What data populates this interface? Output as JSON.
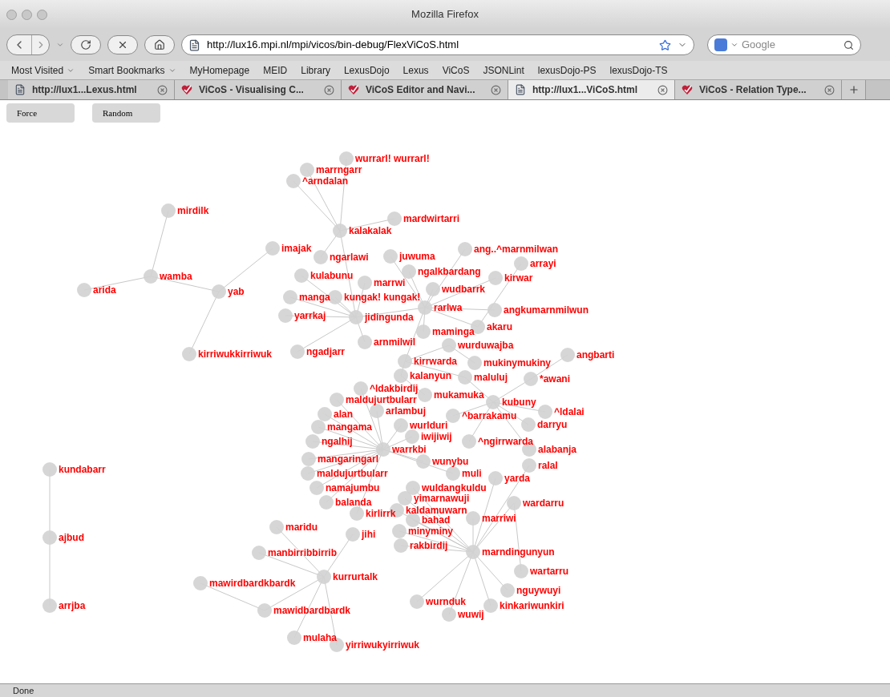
{
  "window": {
    "title": "Mozilla Firefox"
  },
  "toolbar": {
    "url": "http://lux16.mpi.nl/mpi/vicos/bin-debug/FlexViCoS.html",
    "search_placeholder": "Google"
  },
  "bookmarks": [
    {
      "label": "Most Visited",
      "kind": "menu"
    },
    {
      "label": "Smart Bookmarks",
      "kind": "menu"
    },
    {
      "label": "MyHomepage",
      "kind": "link"
    },
    {
      "label": "MEID",
      "kind": "link"
    },
    {
      "label": "Library",
      "kind": "link"
    },
    {
      "label": "LexusDojo",
      "kind": "link"
    },
    {
      "label": "Lexus",
      "kind": "link"
    },
    {
      "label": "ViCoS",
      "kind": "link"
    },
    {
      "label": "JSONLint",
      "kind": "link"
    },
    {
      "label": "lexusDojo-PS",
      "kind": "link"
    },
    {
      "label": "lexusDojo-TS",
      "kind": "link"
    }
  ],
  "tabs": [
    {
      "label": "http://lux1...Lexus.html",
      "kind": "page",
      "selected": false
    },
    {
      "label": "ViCoS - Visualising C...",
      "kind": "vicos",
      "selected": false
    },
    {
      "label": "ViCoS Editor and Navi...",
      "kind": "vicos",
      "selected": false
    },
    {
      "label": "http://lux1...ViCoS.html",
      "kind": "page",
      "selected": true
    },
    {
      "label": "ViCoS - Relation Type...",
      "kind": "vicos",
      "selected": false
    }
  ],
  "buttons": [
    "Force",
    "Random"
  ],
  "graph": {
    "nodes": [
      {
        "label": "kalakalak",
        "children": [
          {
            "label": "wurrarl! wurrarl!"
          },
          {
            "label": "marrngarr"
          },
          {
            "label": "^arndalan"
          },
          {
            "label": "mardwirtarri"
          },
          {
            "label": "ngarlawi"
          },
          {
            "label": "jidingunda",
            "children": [
              {
                "label": "kulabunu"
              },
              {
                "label": "marrwi"
              },
              {
                "label": "manga"
              },
              {
                "label": "kungak! kungak!"
              },
              {
                "label": "rarlwa",
                "children": [
                  {
                    "label": "ang..^marnmilwan"
                  },
                  {
                    "label": "juwuma"
                  },
                  {
                    "label": "ngalkbardang"
                  },
                  {
                    "label": "kirwar"
                  },
                  {
                    "label": "wudbarrk"
                  },
                  {
                    "label": "angkumarnmilwun"
                  },
                  {
                    "label": "akaru",
                    "children": [
                      {
                        "label": "arrayi"
                      }
                    ]
                  },
                  {
                    "label": "maminga"
                  },
                  {
                    "label": "kirrwarda",
                    "children": [
                      {
                        "label": "wurduwajba",
                        "children": [
                          {
                            "label": "mukinymukiny"
                          }
                        ]
                      },
                      {
                        "label": "kalanyun",
                        "children": [
                          {
                            "label": "mukamuka"
                          }
                        ]
                      },
                      {
                        "label": "maluluj",
                        "children": [
                          {
                            "label": "kubuny",
                            "children": [
                              {
                                "label": "*awani",
                                "children": [
                                  {
                                    "label": "angbarti"
                                  }
                                ]
                              },
                              {
                                "label": "^ldalai"
                              },
                              {
                                "label": "^barrakamu"
                              },
                              {
                                "label": "darryu"
                              },
                              {
                                "label": "^ngirrwarda"
                              },
                              {
                                "label": "alabanja"
                              }
                            ]
                          }
                        ]
                      }
                    ]
                  }
                ]
              },
              {
                "label": "yarrkaj"
              },
              {
                "label": "arnmilwil"
              },
              {
                "label": "ngadjarr"
              }
            ]
          }
        ]
      },
      {
        "label": "yab",
        "children": [
          {
            "label": "imajak"
          },
          {
            "label": "wamba",
            "children": [
              {
                "label": "mirdilk"
              },
              {
                "label": "arida"
              }
            ]
          },
          {
            "label": "kirriwukkirriwuk"
          }
        ]
      },
      {
        "label": "warrkbi",
        "children": [
          {
            "label": "^ldakbirdij"
          },
          {
            "label": "maldujurtbularr"
          },
          {
            "label": "arlambuj"
          },
          {
            "label": "alan"
          },
          {
            "label": "wurlduri"
          },
          {
            "label": "mangama"
          },
          {
            "label": "iwijiwij"
          },
          {
            "label": "ngalhij"
          },
          {
            "label": "mangaringarl"
          },
          {
            "label": "wunybu"
          },
          {
            "label": "maldujurtbularr"
          },
          {
            "label": "muli"
          },
          {
            "label": "namajumbu"
          },
          {
            "label": "balanda"
          },
          {
            "label": "kirlirrk"
          }
        ]
      },
      {
        "label": "kundabarr",
        "children": [
          {
            "label": "ajbud",
            "children": [
              {
                "label": "arrjba"
              }
            ]
          }
        ]
      },
      {
        "label": "marndingunyun",
        "children": [
          {
            "label": "ralal"
          },
          {
            "label": "yarda"
          },
          {
            "label": "wuldangkuldu"
          },
          {
            "label": "yimarnawuji"
          },
          {
            "label": "wardarru",
            "children": [
              {
                "label": "wartarru"
              }
            ]
          },
          {
            "label": "kaldamuwarn"
          },
          {
            "label": "marriwi"
          },
          {
            "label": "bahad"
          },
          {
            "label": "minyminy"
          },
          {
            "label": "rakbirdij"
          },
          {
            "label": "nguywuyi"
          },
          {
            "label": "wurnduk"
          },
          {
            "label": "kinkariwunkiri"
          },
          {
            "label": "wuwij"
          }
        ]
      },
      {
        "label": "kurrurtalk",
        "children": [
          {
            "label": "maridu"
          },
          {
            "label": "jihi"
          },
          {
            "label": "manbirribbirrib"
          },
          {
            "label": "mawidbardbardk",
            "children": [
              {
                "label": "mawirdbardkbardk"
              }
            ]
          },
          {
            "label": "mulaha"
          },
          {
            "label": "yirriwukyirriwuk"
          }
        ]
      }
    ]
  },
  "status_bar": "Done"
}
